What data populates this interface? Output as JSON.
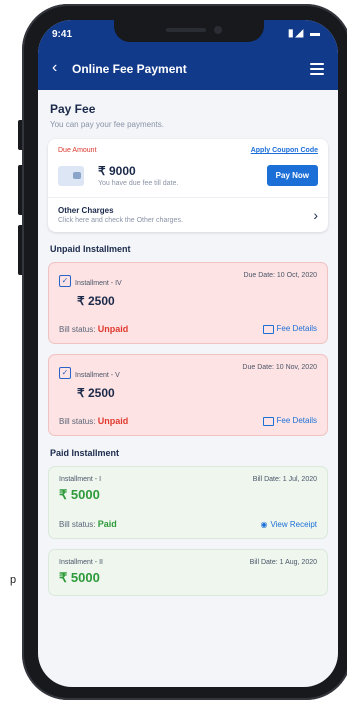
{
  "side_glyph": "p",
  "status": {
    "time": "9:41",
    "icons": "▮◢ ▬"
  },
  "appbar": {
    "title": "Online Fee Payment"
  },
  "pay_fee": {
    "title": "Pay Fee",
    "subtitle": "You can pay your fee payments."
  },
  "due_card": {
    "label": "Due Amount",
    "coupon": "Apply Coupon Code",
    "amount": "₹ 9000",
    "note": "You have due fee till date.",
    "pay_button": "Pay Now",
    "other_title": "Other Charges",
    "other_sub": "Click here and check the Other charges."
  },
  "unpaid": {
    "title": "Unpaid Installment",
    "items": [
      {
        "name": "Installment - IV",
        "due": "Due Date: 10 Oct, 2020",
        "amount": "₹ 2500",
        "bill_label": "Bill status:",
        "status": "Unpaid",
        "link": "Fee Details"
      },
      {
        "name": "Installment - V",
        "due": "Due Date: 10 Nov, 2020",
        "amount": "₹ 2500",
        "bill_label": "Bill status:",
        "status": "Unpaid",
        "link": "Fee Details"
      }
    ]
  },
  "paid": {
    "title": "Paid Installment",
    "items": [
      {
        "name": "Installment - I",
        "date": "Bill Date: 1 Jul, 2020",
        "amount": "₹ 5000",
        "bill_label": "Bill status:",
        "status": "Paid",
        "link": "View Receipt"
      },
      {
        "name": "Installment - II",
        "date": "Bill Date: 1 Aug, 2020",
        "amount": "₹ 5000"
      }
    ]
  },
  "colors": {
    "primary": "#123a8a",
    "accent": "#1d6fd8",
    "unpaid": "#e03a2f",
    "paid": "#2e9a3a"
  }
}
